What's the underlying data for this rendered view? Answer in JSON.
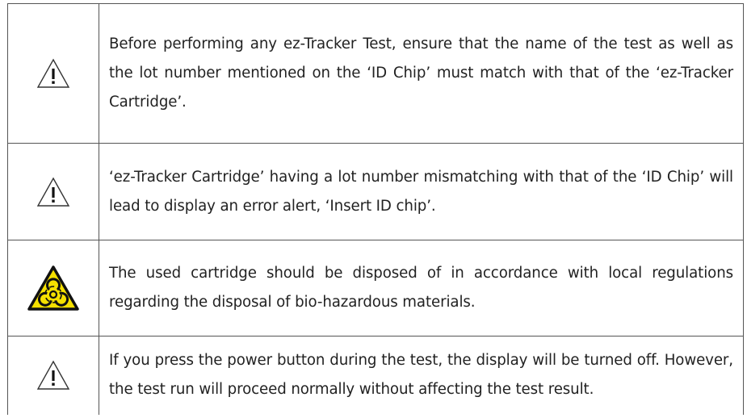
{
  "notices": [
    {
      "icon": "warning-triangle-icon",
      "text": "Before performing any ez-Tracker Test, ensure that the name of the test as well as the lot number mentioned on the ‘ID Chip’ must match with that of the ‘ez-Tracker Cartridge’."
    },
    {
      "icon": "warning-triangle-icon",
      "text": "‘ez-Tracker Cartridge’ having a lot number mismatching with that of the ‘ID Chip’ will lead to display an error alert, ‘Insert ID chip’."
    },
    {
      "icon": "biohazard-icon",
      "text": "The used cartridge should be disposed of in accordance with local regulations regarding the disposal of bio-hazardous materials."
    },
    {
      "icon": "warning-triangle-icon",
      "text": "If you press the power button during the test, the display will be turned off. However, the test run will proceed normally without affecting the test result."
    }
  ],
  "colors": {
    "border": "#555555",
    "biohazard_yellow": "#f5e000",
    "text": "#222222"
  }
}
